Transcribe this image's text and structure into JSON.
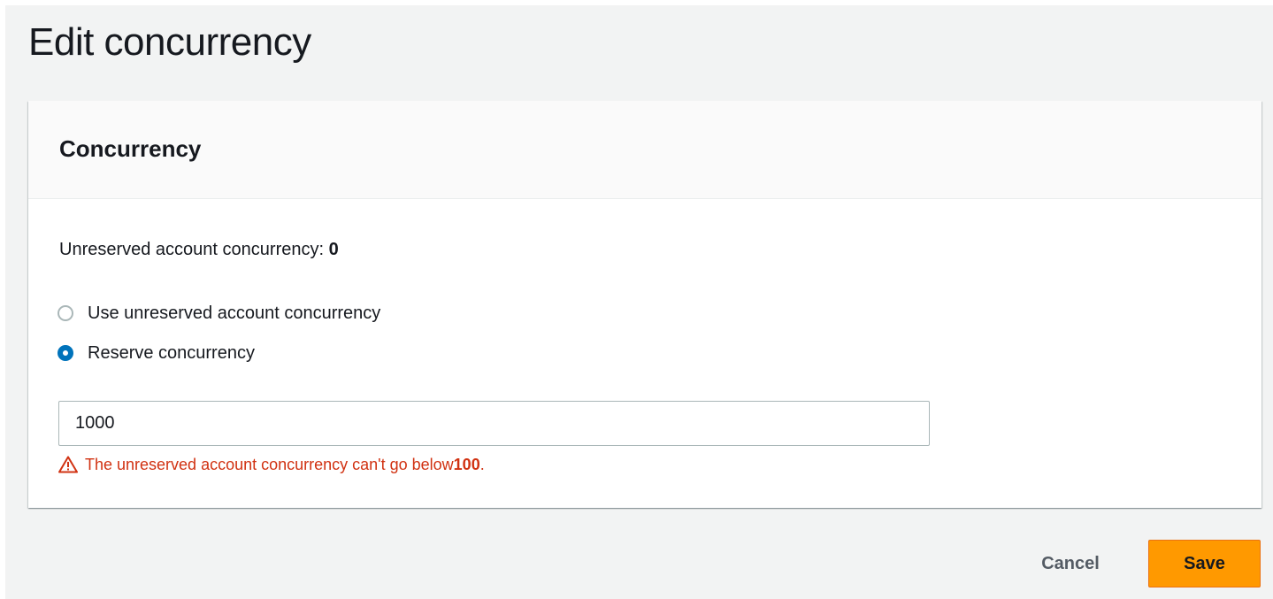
{
  "page": {
    "title": "Edit concurrency"
  },
  "panel": {
    "title": "Concurrency",
    "unreserved_label": "Unreserved account concurrency: ",
    "unreserved_value": "0"
  },
  "options": [
    {
      "label": "Use unreserved account concurrency",
      "selected": false
    },
    {
      "label": "Reserve concurrency",
      "selected": true
    }
  ],
  "reserve_input": {
    "value": "1000"
  },
  "error": {
    "icon": "warning-icon",
    "text": "The unreserved account concurrency can't go below ",
    "value": "100",
    "suffix": "."
  },
  "actions": {
    "cancel_label": "Cancel",
    "save_label": "Save"
  },
  "colors": {
    "background": "#f2f3f3",
    "selected_radio": "#0073bb",
    "error": "#d13212",
    "primary_button": "#ff9900"
  }
}
